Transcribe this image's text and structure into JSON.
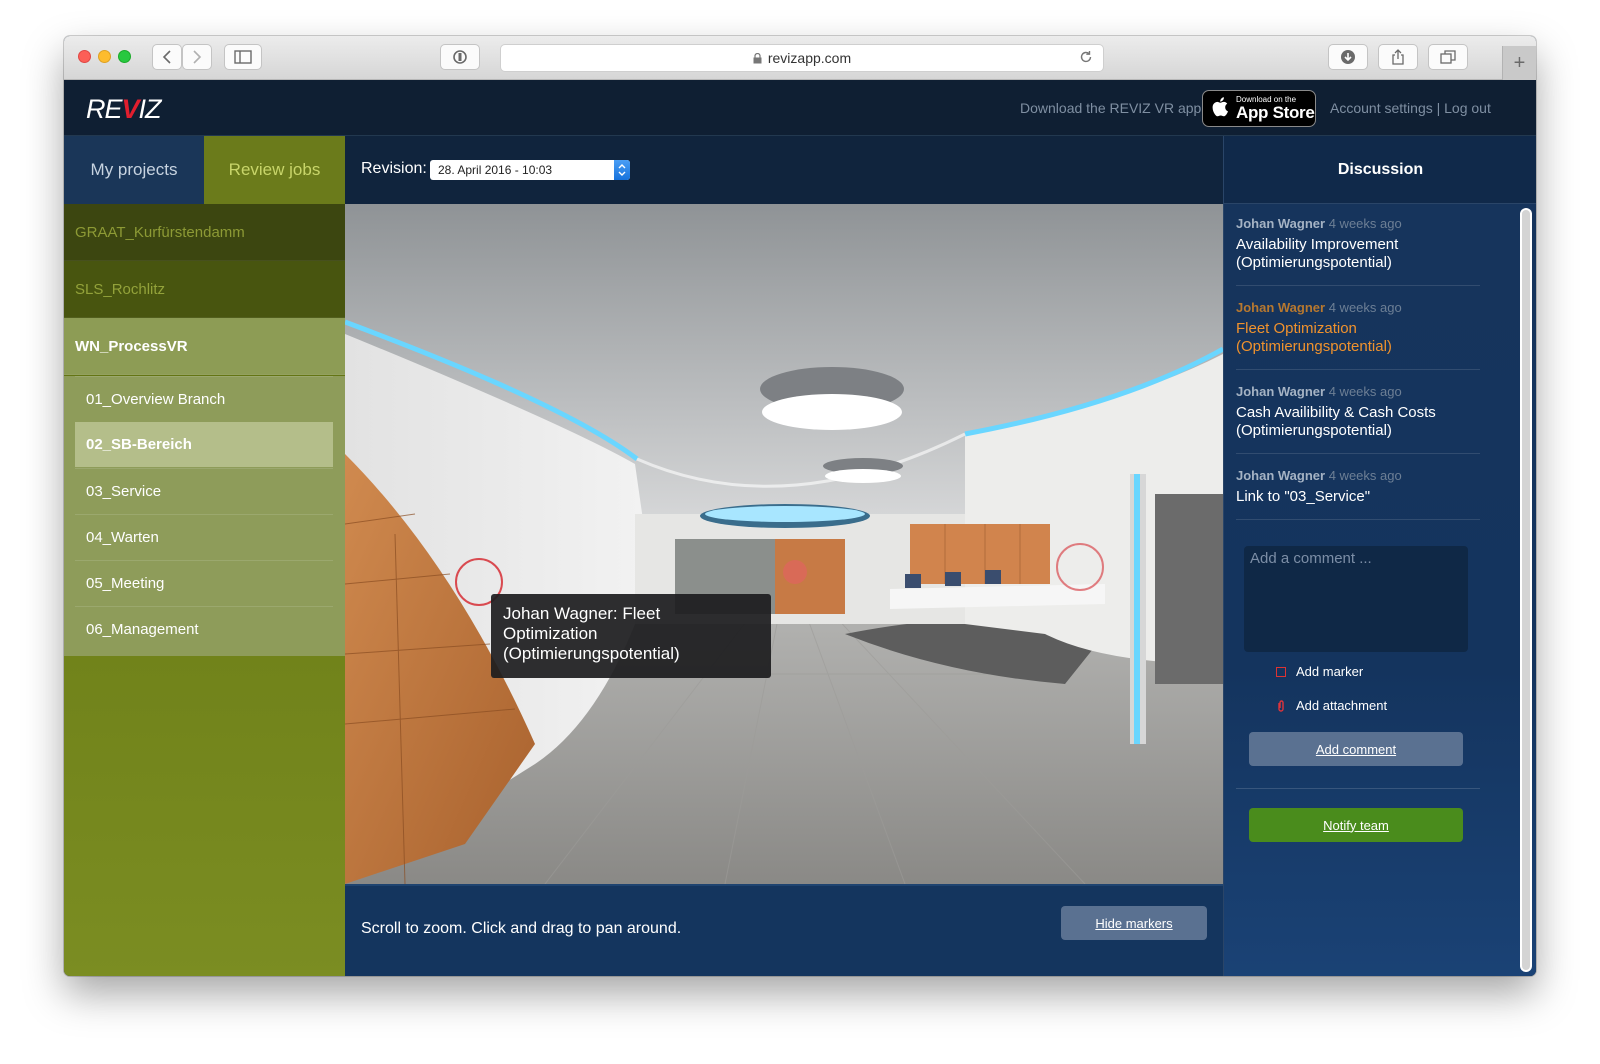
{
  "browser": {
    "url": "revizapp.com"
  },
  "header": {
    "logo_text": "REVIZ",
    "download_text": "Download the REVIZ VR app",
    "appstore_small": "Download on the",
    "appstore_big": "App Store",
    "account_links": "Account settings | Log out"
  },
  "sidebar": {
    "tabs": [
      {
        "label": "My projects",
        "active": false
      },
      {
        "label": "Review jobs",
        "active": true
      }
    ],
    "projects": [
      {
        "label": "GRAAT_Kurfürstendamm"
      },
      {
        "label": "SLS_Rochlitz"
      },
      {
        "label": "WN_ProcessVR"
      }
    ],
    "scenes": [
      {
        "label": "01_Overview Branch"
      },
      {
        "label": "02_SB-Bereich",
        "selected": true
      },
      {
        "label": "03_Service"
      },
      {
        "label": "04_Warten"
      },
      {
        "label": "05_Meeting"
      },
      {
        "label": "06_Management"
      }
    ]
  },
  "viewer": {
    "revision_label": "Revision:",
    "revision_value": "28. April 2016 - 10:03",
    "tooltip": "Johan Wagner: Fleet Optimization (Optimierungspotential)",
    "hint": "Scroll to zoom. Click and drag to pan around.",
    "hide_markers_label": "Hide markers"
  },
  "discussion": {
    "title": "Discussion",
    "comments": [
      {
        "author": "Johan Wagner",
        "time": "4 weeks ago",
        "text": "Availability Improvement (Optimierungspotential)",
        "highlighted": false
      },
      {
        "author": "Johan Wagner",
        "time": "4 weeks ago",
        "text": "Fleet Optimization (Optimierungspotential)",
        "highlighted": true
      },
      {
        "author": "Johan Wagner",
        "time": "4 weeks ago",
        "text": "Cash Availibility & Cash Costs (Optimierungspotential)",
        "highlighted": false
      },
      {
        "author": "Johan Wagner",
        "time": "4 weeks ago",
        "text": "Link to \"03_Service\"",
        "highlighted": false
      }
    ],
    "comment_placeholder": "Add a comment ...",
    "add_marker_label": "Add marker",
    "add_attachment_label": "Add attachment",
    "add_comment_label": "Add comment",
    "notify_team_label": "Notify team"
  },
  "colors": {
    "accent_orange": "#f0922d",
    "sidebar_green": "#6b7d16",
    "notify_green": "#4a8c1c",
    "marker_red": "#d94a50",
    "logo_red": "#e01e2e"
  }
}
